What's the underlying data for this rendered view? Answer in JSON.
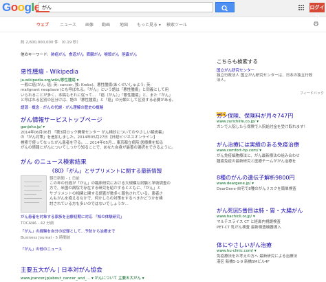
{
  "search": {
    "query": "がん"
  },
  "header": {
    "login_label": "ログイン"
  },
  "tabs": [
    {
      "label": "ウェブ"
    },
    {
      "label": "ニュース"
    },
    {
      "label": "画像"
    },
    {
      "label": "動画"
    },
    {
      "label": "地図"
    },
    {
      "label": "もっと見る ▾"
    },
    {
      "label": "検索ツール"
    }
  ],
  "stats": "約 2,600,000,000 件 （0.19 秒）",
  "keywords": {
    "label": "他のキーワード:",
    "items": [
      "肺癌がん",
      "食道がん",
      "膵臓がん",
      "喉頭がん",
      "胆嚢がん"
    ]
  },
  "results": [
    {
      "title": "悪性腫瘍 - Wikipedia",
      "url": "ja.wikipedia.org/wiki/悪性腫瘍 ▾",
      "snippet": [
        "一般に癌(がん, 癌; 英: cancer, 独: Krebs)、悪性腫瘍(あくせいしゅよう; 英:",
        "malignant neoplasm)とも呼ばれる。「がん」という語は「悪性腫瘍」と同義として用",
        "いられることが多く、本稿もそれに従って... 「癌（がん）」「悪性腫瘍」と、また「がん」",
        "と呼ばれる区別の区分けは、語の「悪性腫瘍」と「癌」の分類として区別する必要がある。"
      ],
      "sublinks": "語源 · 概念 · がんの代謝 · がん理解の歴史の概略"
    },
    {
      "title": "がん情報サービストップページ",
      "url": "ganjoho.jp/ ▾",
      "snippet": [
        "2014年06月06日 「第3回ロック開発センター がん検診についてのやさしい解説書」",
        "の「がん対策」を追加しました。2014年05月27日【日経ビジネスオンライン】",
        "検索で使ってなったがん患者を守る。… 2014年05月... 東京都立病院 医療費を知る",
        "がんの情報とがんについてしっかり知ることで、あなた自身が最善の選択をできるように。"
      ]
    }
  ],
  "news": {
    "header": "がん のニュース検索結果",
    "main_title": "《80》「がん」とサプリメントに関する最新情報",
    "main_source": "朝日新聞 - 1 日前",
    "main_snippet": [
      "この年の日経が「がん」の臨床研究における大規模な試験と学術調査の",
      "方で、米国の病院で存在する研究を紹介するとともに、「がん」と",
      "サプリメントの相関に関する調査が数多く報告されている。患者さ",
      "んもがんを抱えるなかで、何かしらの対策をするべきかどうかを検",
      "討されている方も多いのではないでしょうか..."
    ],
    "other_title": "がん患者を対象する家族を治療初期に対応 「知の体験研究」",
    "other_source": "TOCANA - 42 分前",
    "third_title": "「がん」の経験を自分の記録として…予防から治療まで",
    "third_source": "Business Journal - 5 時間前",
    "more_label": "「がん」の他のニュース"
  },
  "result3": {
    "title": "主要五大がん | 日本対がん協会",
    "url": "www.jcancer.jp/about_cancer_and_... ▾ がんについて 主要五大がん ▾"
  },
  "right": {
    "header": "こちらも検索する",
    "kb_link": "国立がん研究センター",
    "kb_text": [
      "独立行政法人 国立がん研究センターは、日本の独立行政",
      "法人。"
    ],
    "feedback": "フィードバック",
    "ad_badge": "広告",
    "ads": [
      {
        "title": "ガン保険、保険料が月々747円",
        "url": "www.zurichlife.co.jp/ ▾",
        "lines": [
          "ガンで入院したら保険で入院給付金を受け取れます！"
        ]
      },
      {
        "title": "がん治療には実績のある免疫治療",
        "url": "www.comfort-hp.com/ ▾",
        "lines": [
          "がん免疫細胞療法と、がん最新療法の組み合わせ",
          "腫瘍免疫の最新研究と医療チームががん治療を"
        ]
      },
      {
        "title": "8種のがんの遺伝子解析9800円",
        "url": "www.deargene.jp/ ▾",
        "lines": [
          "DearGene-自宅で8種のがんリスクを簡単検査"
        ]
      },
      {
        "title": "がん死因5番目は肺・胃・大腸がん",
        "url": "www.hachicli.or.jp/ ▾",
        "lines": [
          "マルチスライス CT と経鼻内視鏡検査",
          "PET-CT 乳がん検査 最新検査機器導入"
        ]
      },
      {
        "title": "体にやさしいがん治療",
        "url": "www.hu-clinic.com/ ▾",
        "lines": [
          "免疫療法をお考えの方へ 最新研究による治療法",
          "港区 新橋5-1-9 新橋SMビル4F"
        ]
      }
    ]
  },
  "colors": {
    "accent": "#dd4b39",
    "link": "#1a0dab",
    "url": "#006621",
    "search_btn": "#4d8ff3"
  }
}
